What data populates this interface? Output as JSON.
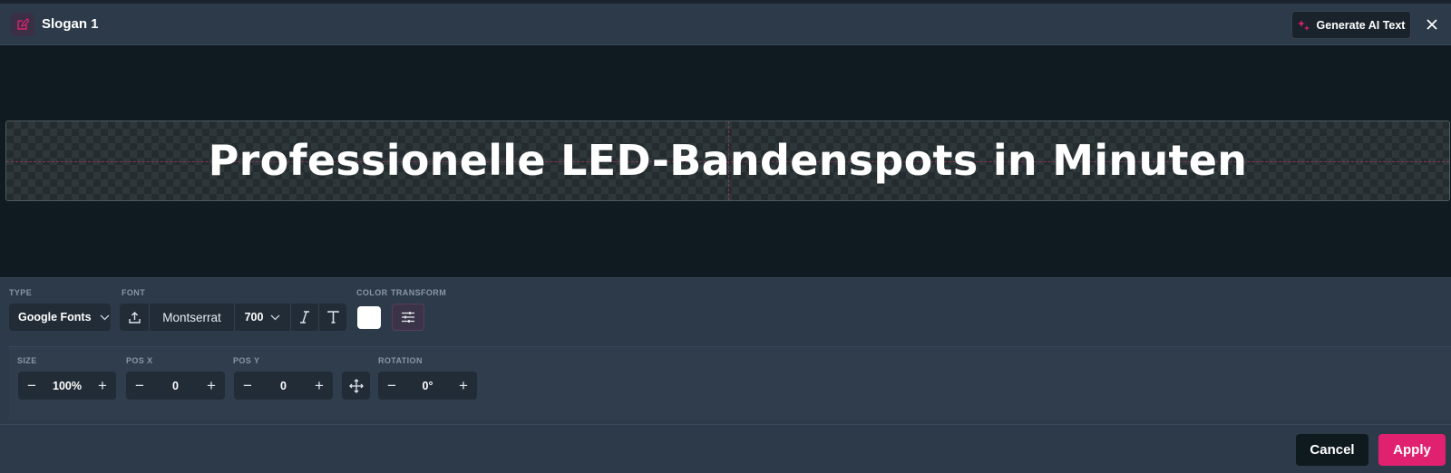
{
  "header": {
    "title": "Slogan 1",
    "edit_icon": "edit-icon",
    "generate_ai_label": "Generate AI Text",
    "sparkle_icon": "sparkle-icon",
    "close_icon": "close-icon"
  },
  "preview": {
    "slogan_text": "Professionelle LED-Bandenspots in Minuten",
    "text_color": "#ffffff"
  },
  "controls": {
    "type": {
      "label": "TYPE",
      "value": "Google Fonts"
    },
    "font": {
      "label": "FONT",
      "family": "Montserrat",
      "weight": "700"
    },
    "color": {
      "label": "COLOR",
      "value": "#ffffff"
    },
    "transform": {
      "label": "TRANSFORM"
    },
    "size": {
      "label": "SIZE",
      "value": "100%"
    },
    "pos_x": {
      "label": "POS X",
      "value": "0"
    },
    "pos_y": {
      "label": "POS Y",
      "value": "0"
    },
    "rotation": {
      "label": "ROTATION",
      "value": "0°"
    }
  },
  "footer": {
    "cancel_label": "Cancel",
    "apply_label": "Apply"
  },
  "colors": {
    "accent": "#e0216f",
    "background": "#2c3a49",
    "preview_bg": "#0f1b20"
  }
}
